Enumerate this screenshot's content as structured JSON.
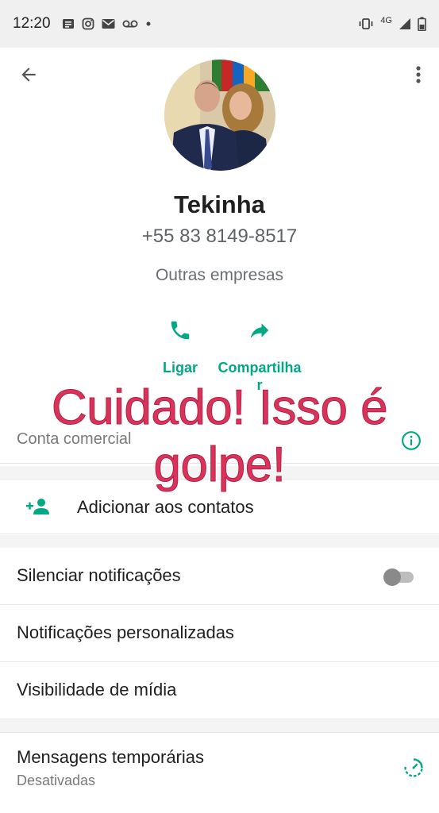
{
  "status_bar": {
    "time": "12:20",
    "network": "4G"
  },
  "contact": {
    "name": "Tekinha",
    "phone": "+55 83 8149-8517",
    "category": "Outras empresas"
  },
  "actions": [
    {
      "label": "Ligar",
      "icon": "phone-icon"
    },
    {
      "label": "Compartilhar",
      "icon": "share-icon"
    }
  ],
  "business_account": {
    "label": "Conta comercial",
    "icon": "info-icon"
  },
  "add_contact": {
    "label": "Adicionar aos contatos",
    "icon": "add-person-icon"
  },
  "settings": {
    "mute": {
      "label": "Silenciar notificações",
      "enabled": false
    },
    "custom_notifications": {
      "label": "Notificações personalizadas"
    },
    "media_visibility": {
      "label": "Visibilidade de mídia"
    },
    "temporary_messages": {
      "label": "Mensagens temporárias",
      "status": "Desativadas"
    }
  },
  "overlay_warning": "Cuidado! Isso é golpe!",
  "colors": {
    "accent": "#00a884",
    "warning_text": "#d8335b"
  }
}
